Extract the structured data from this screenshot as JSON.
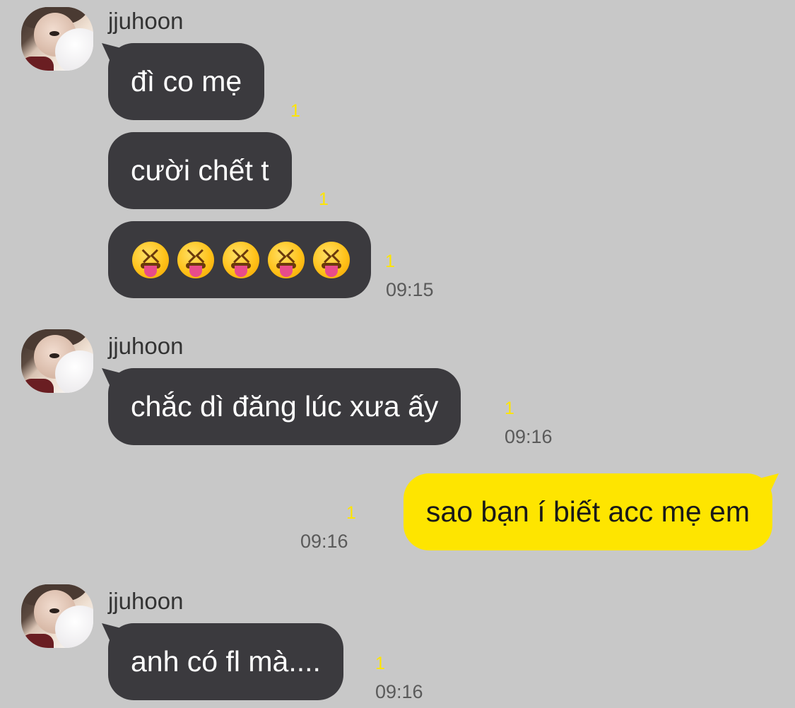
{
  "groups": [
    {
      "sender": "jjuhoon",
      "messages": [
        {
          "text": "đì co mẹ",
          "unread": "1"
        },
        {
          "text": "cười chết t",
          "unread": "1"
        },
        {
          "text": "😝😝😝😝😝",
          "unread": "1",
          "time": "09:15"
        }
      ]
    },
    {
      "sender": "jjuhoon",
      "messages": [
        {
          "text": "chắc dì đăng lúc xưa ấy",
          "unread": "1",
          "time": "09:16"
        }
      ]
    },
    {
      "mine": true,
      "messages": [
        {
          "text": "sao bạn í biết acc mẹ em",
          "unread": "1",
          "time": "09:16"
        }
      ]
    },
    {
      "sender": "jjuhoon",
      "messages": [
        {
          "text": "anh có fl mà....",
          "unread": "1",
          "time": "09:16"
        }
      ]
    }
  ],
  "colors": {
    "background": "#c8c8c8",
    "received_bubble": "#3b3a3e",
    "sent_bubble": "#fee500",
    "unread_count": "#fee500"
  },
  "icons": {
    "emoji": "squinting-face-with-tongue"
  }
}
